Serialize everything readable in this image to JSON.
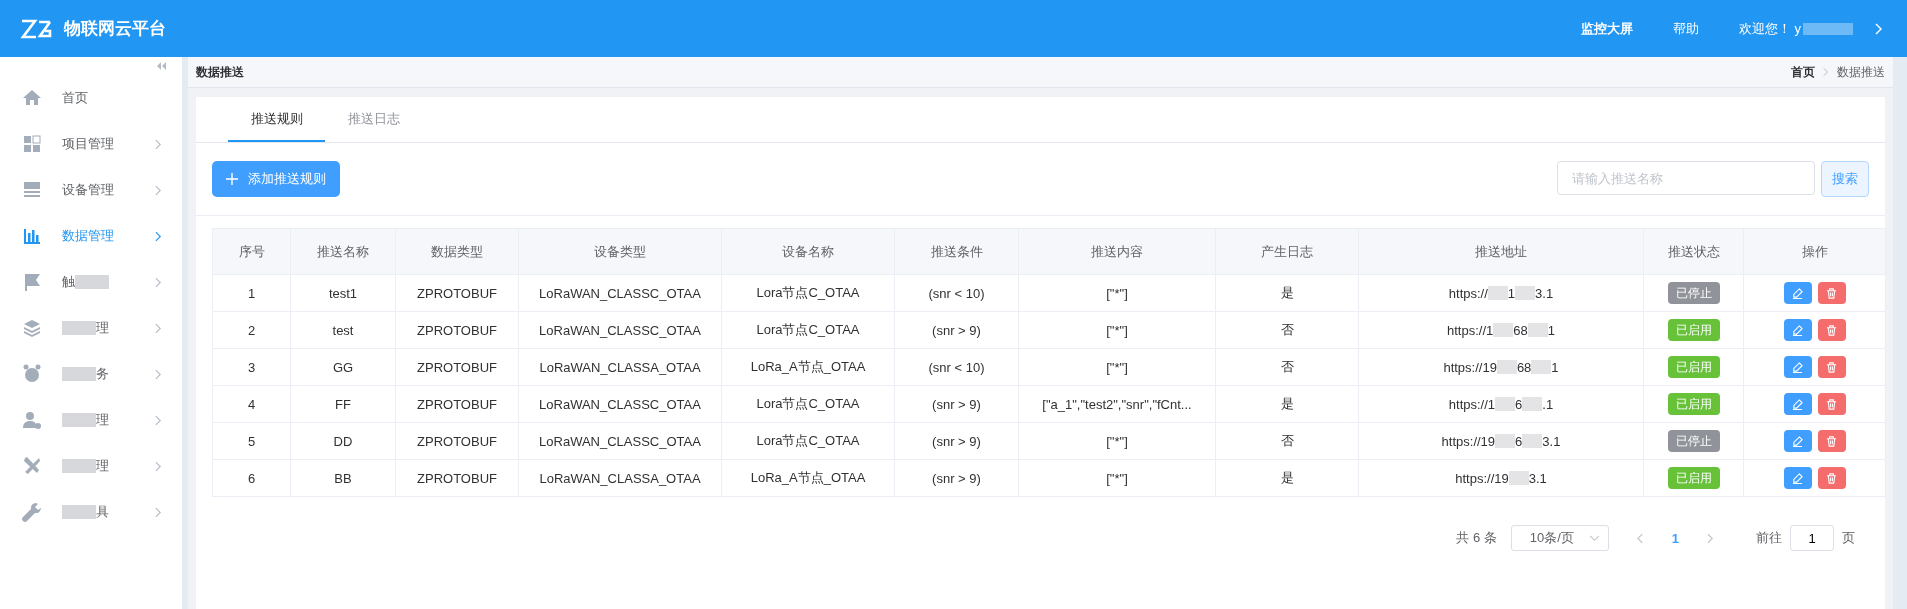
{
  "header": {
    "title": "物联网云平台",
    "links": [
      "监控大屏",
      "帮助"
    ],
    "welcome": "欢迎您！ y"
  },
  "sidebar": {
    "items": [
      {
        "label": "首页",
        "selected": false,
        "expandable": false
      },
      {
        "label": "项目管理",
        "selected": false,
        "expandable": true
      },
      {
        "label": "设备管理",
        "selected": false,
        "expandable": true
      },
      {
        "label": "数据管理",
        "selected": true,
        "expandable": true
      },
      {
        "label": "触",
        "blurred_after": true,
        "selected": false,
        "expandable": true
      },
      {
        "label": "理",
        "blurred_before": true,
        "selected": false,
        "expandable": true
      },
      {
        "label": "务",
        "blurred_before": true,
        "selected": false,
        "expandable": true
      },
      {
        "label": "理",
        "blurred_before": true,
        "selected": false,
        "expandable": true
      },
      {
        "label": "理",
        "blurred_before": true,
        "selected": false,
        "expandable": true
      },
      {
        "label": "具",
        "blurred_before": true,
        "selected": false,
        "expandable": true
      }
    ]
  },
  "page_title": "数据推送",
  "breadcrumb": [
    "首页",
    "数据推送"
  ],
  "tabs": [
    {
      "label": "推送规则",
      "selected": true
    },
    {
      "label": "推送日志",
      "selected": false
    }
  ],
  "add_button": "添加推送规则",
  "search": {
    "placeholder": "请输入推送名称",
    "button": "搜索"
  },
  "table": {
    "columns": [
      "序号",
      "推送名称",
      "数据类型",
      "设备类型",
      "设备名称",
      "推送条件",
      "推送内容",
      "产生日志",
      "推送地址",
      "推送状态",
      "操作"
    ],
    "rows": [
      {
        "cells": [
          "1",
          "test1",
          "ZPROTOBUF",
          "LoRaWAN_CLASSC_OTAA",
          "Lora节点C_OTAA",
          "(snr < 10)",
          "[\"*\"]",
          "是"
        ],
        "url_parts": [
          "https://",
          "1",
          "3.1"
        ],
        "status": "已停止",
        "enabled": false
      },
      {
        "cells": [
          "2",
          "test",
          "ZPROTOBUF",
          "LoRaWAN_CLASSC_OTAA",
          "Lora节点C_OTAA",
          "(snr > 9)",
          "[\"*\"]",
          "否"
        ],
        "url_parts": [
          "https://1",
          "68",
          "1"
        ],
        "status": "已启用",
        "enabled": true
      },
      {
        "cells": [
          "3",
          "GG",
          "ZPROTOBUF",
          "LoRaWAN_CLASSA_OTAA",
          "LoRa_A节点_OTAA",
          "(snr < 10)",
          "[\"*\"]",
          "否"
        ],
        "url_parts": [
          "https://19",
          "68",
          "1"
        ],
        "status": "已启用",
        "enabled": true
      },
      {
        "cells": [
          "4",
          "FF",
          "ZPROTOBUF",
          "LoRaWAN_CLASSC_OTAA",
          "Lora节点C_OTAA",
          "(snr > 9)",
          "[\"a_1\",\"test2\",\"snr\",\"fCnt...",
          "是"
        ],
        "url_parts": [
          "https://1",
          "6",
          ".1"
        ],
        "status": "已启用",
        "enabled": true
      },
      {
        "cells": [
          "5",
          "DD",
          "ZPROTOBUF",
          "LoRaWAN_CLASSC_OTAA",
          "Lora节点C_OTAA",
          "(snr > 9)",
          "[\"*\"]",
          "否"
        ],
        "url_parts": [
          "https://19",
          "6",
          "3.1"
        ],
        "status": "已停止",
        "enabled": false
      },
      {
        "cells": [
          "6",
          "BB",
          "ZPROTOBUF",
          "LoRaWAN_CLASSA_OTAA",
          "LoRa_A节点_OTAA",
          "(snr > 9)",
          "[\"*\"]",
          "是"
        ],
        "url_parts": [
          "https://19",
          "3.1"
        ],
        "status": "已启用",
        "enabled": true
      }
    ]
  },
  "pagination": {
    "total": "共 6 条",
    "page_size": "10条/页",
    "current": "1",
    "goto_label": "前往",
    "goto_value": "1",
    "goto_suffix": "页"
  }
}
